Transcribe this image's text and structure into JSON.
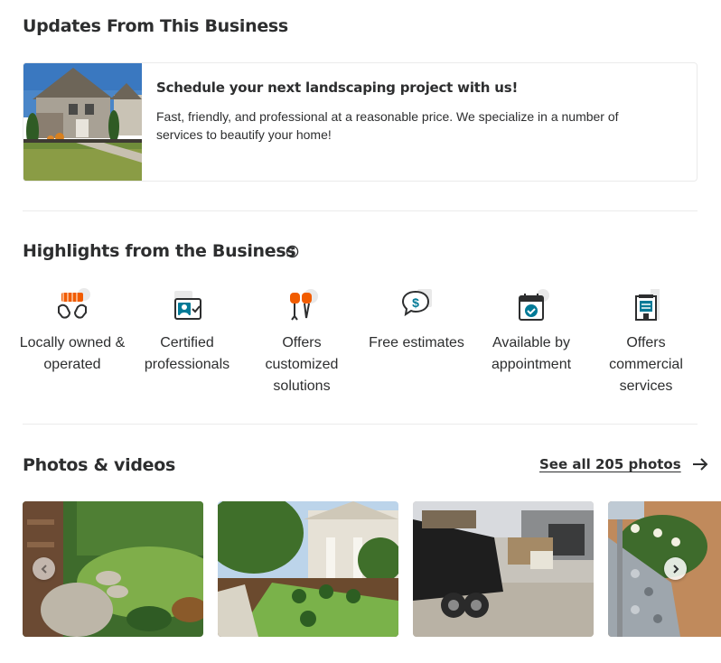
{
  "updates": {
    "title": "Updates From This Business",
    "card": {
      "heading": "Schedule your next landscaping project with us!",
      "text": "Fast, friendly, and professional at a reasonable price. We specialize in a number of services to beautify your home!"
    }
  },
  "highlights": {
    "title": "Highlights from the Business",
    "items": [
      {
        "label": "Locally owned & operated",
        "icon": "locally-owned-icon"
      },
      {
        "label": "Certified professionals",
        "icon": "certified-icon"
      },
      {
        "label": "Offers customized solutions",
        "icon": "customized-icon"
      },
      {
        "label": "Free estimates",
        "icon": "estimate-icon"
      },
      {
        "label": "Available by appointment",
        "icon": "appointment-icon"
      },
      {
        "label": "Offers commercial services",
        "icon": "commercial-icon"
      }
    ]
  },
  "photos": {
    "title": "Photos & videos",
    "see_all": "See all 205 photos"
  },
  "colors": {
    "accent_orange": "#f15c00",
    "accent_teal": "#027a97",
    "text": "#2d2e2f",
    "border": "#ebebeb"
  }
}
